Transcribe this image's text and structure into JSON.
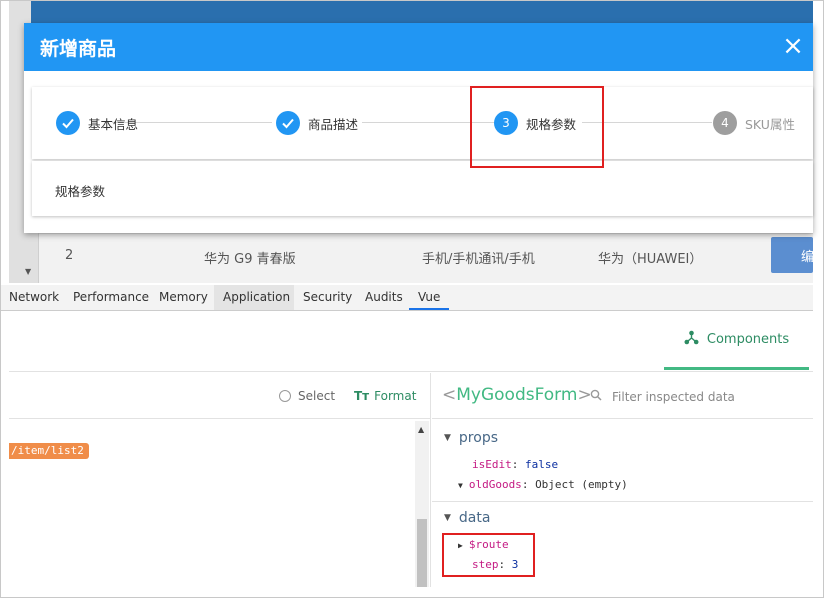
{
  "dialog": {
    "title": "新增商品",
    "close_icon": "×"
  },
  "steps": [
    {
      "label": "基本信息",
      "state": "done",
      "icon": "check-icon"
    },
    {
      "label": "商品描述",
      "state": "done",
      "icon": "check-icon"
    },
    {
      "label": "规格参数",
      "state": "active",
      "number": "3"
    },
    {
      "label": "SKU属性",
      "state": "pending",
      "number": "4"
    }
  ],
  "content": {
    "text": "规格参数"
  },
  "background_row": {
    "index": "2",
    "name": "华为 G9 青春版",
    "category": "手机/手机通讯/手机",
    "brand": "华为（HUAWEI）",
    "action": "编"
  },
  "devtools": {
    "tabs": [
      "Network",
      "Performance",
      "Memory",
      "Application",
      "Security",
      "Audits",
      "Vue"
    ],
    "selected_tab": "Vue"
  },
  "vue": {
    "components_tab": "Components",
    "select_label": "Select",
    "format_label": "Format",
    "route_badge": "/item/list2",
    "component_name": "MyGoodsForm",
    "filter_placeholder": "Filter inspected data",
    "props_title": "props",
    "props": [
      {
        "key": "isEdit",
        "value": "false",
        "type": "boolean"
      },
      {
        "key": "oldGoods",
        "value": "Object (empty)",
        "type": "object"
      }
    ],
    "data_title": "data",
    "data": [
      {
        "key": "$route",
        "value": "",
        "type": "object"
      },
      {
        "key": "step",
        "value": "3",
        "type": "number"
      }
    ]
  },
  "colors": {
    "dialog_header": "#2196f3",
    "vue_green": "#42b983",
    "highlight_red": "#e02020"
  }
}
